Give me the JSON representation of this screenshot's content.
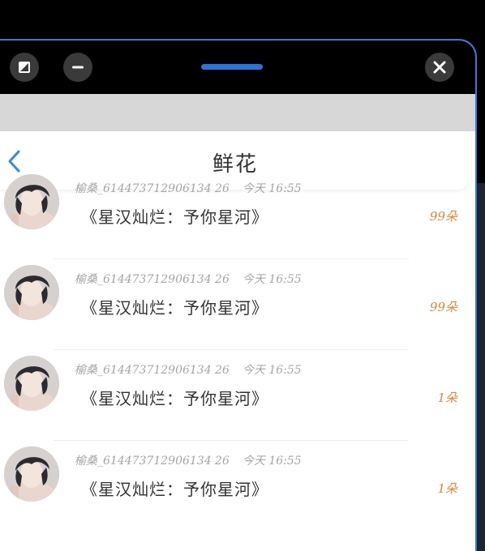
{
  "titlebar": {
    "restore_icon": "restore-icon",
    "minimize_icon": "minus-icon",
    "close_icon": "close-icon",
    "accent": "#2a74d8"
  },
  "header": {
    "back_icon": "chevron-left-icon",
    "title": "鲜花"
  },
  "items": [
    {
      "user": "榆桑_614473712906134 26",
      "time": "今天 16:55",
      "message": "《星汉灿烂：予你星河》",
      "count": "99朵"
    },
    {
      "user": "榆桑_614473712906134 26",
      "time": "今天 16:55",
      "message": "《星汉灿烂：予你星河》",
      "count": "99朵"
    },
    {
      "user": "榆桑_614473712906134 26",
      "time": "今天 16:55",
      "message": "《星汉灿烂：予你星河》",
      "count": "1朵"
    },
    {
      "user": "榆桑_614473712906134 26",
      "time": "今天 16:55",
      "message": "《星汉灿烂：予你星河》",
      "count": "1朵"
    }
  ],
  "colors": {
    "count": "#e8833a",
    "back": "#2b8fe0",
    "window_border": "#3a78d6"
  }
}
